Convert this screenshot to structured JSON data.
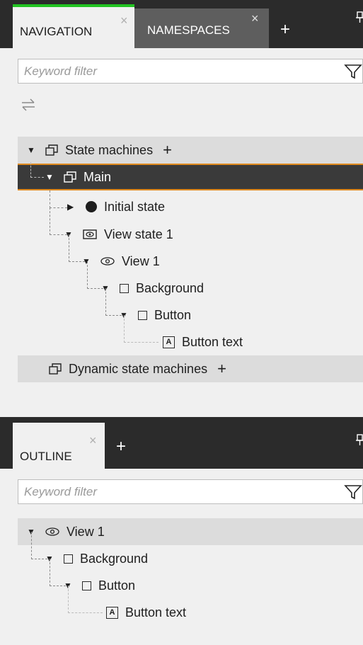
{
  "navigation_panel": {
    "tabs": [
      {
        "label": "NAVIGATION",
        "close": "×"
      },
      {
        "label": "NAMESPACES",
        "close": "×"
      }
    ],
    "add_tab": "+",
    "pin_icon": "pin-icon",
    "filter": {
      "placeholder": "Keyword filter"
    },
    "tree": {
      "state_machines": {
        "label": "State machines",
        "add": "+"
      },
      "main": {
        "label": "Main"
      },
      "initial_state": {
        "label": "Initial state"
      },
      "view_state": {
        "label": "View state 1"
      },
      "view": {
        "label": "View 1"
      },
      "background": {
        "label": "Background"
      },
      "button": {
        "label": "Button"
      },
      "button_text": {
        "label": "Button text"
      },
      "dynamic_state_machines": {
        "label": "Dynamic state machines",
        "add": "+"
      }
    }
  },
  "outline_panel": {
    "tabs": [
      {
        "label": "OUTLINE",
        "close": "×"
      }
    ],
    "add_tab": "+",
    "pin_icon": "pin-icon",
    "filter": {
      "placeholder": "Keyword filter"
    },
    "tree": {
      "view": {
        "label": "View 1"
      },
      "background": {
        "label": "Background"
      },
      "button": {
        "label": "Button"
      },
      "button_text": {
        "label": "Button text"
      }
    }
  },
  "colors": {
    "active_tab_accent": "#22c322",
    "selection_border": "#e08a1e",
    "dark_chrome": "#2b2b2b",
    "panel_bg": "#f0f0f0",
    "tree_band": "#dcdcdc"
  }
}
